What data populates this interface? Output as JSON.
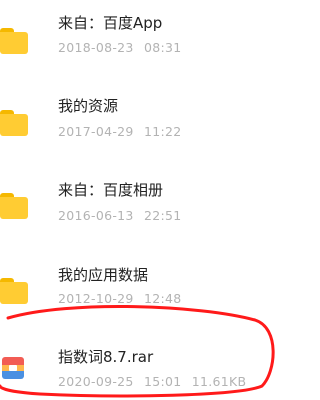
{
  "files": [
    {
      "name": "来自：百度App",
      "date": "2018-08-23",
      "time": "08:31",
      "size": "",
      "icon": "folder-icon"
    },
    {
      "name": "我的资源",
      "date": "2017-04-29",
      "time": "11:22",
      "size": "",
      "icon": "folder-icon"
    },
    {
      "name": "来自：百度相册",
      "date": "2016-06-13",
      "time": "22:51",
      "size": "",
      "icon": "folder-icon"
    },
    {
      "name": "我的应用数据",
      "date": "2012-10-29",
      "time": "12:48",
      "size": "",
      "icon": "folder-icon"
    },
    {
      "name": "指数词8.7.rar",
      "date": "2020-09-25",
      "time": "15:01",
      "size": "11.61KB",
      "icon": "rar-archive-icon"
    }
  ],
  "colors": {
    "folder": "#ffcc33",
    "folder_tab": "#f5b800",
    "archive_top": "#f25c54",
    "archive_mid": "#ffb74d",
    "archive_bottom": "#4a90e2",
    "highlight": "#ff1a1a"
  }
}
